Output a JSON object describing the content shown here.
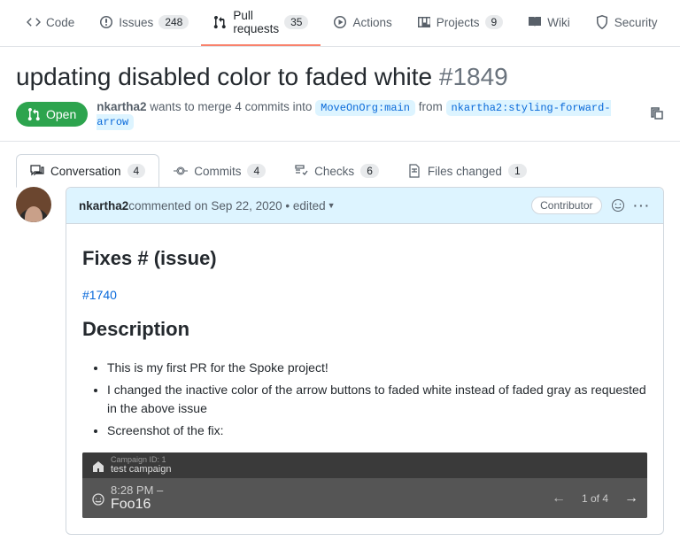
{
  "repoNav": {
    "code": "Code",
    "issues": "Issues",
    "issuesCount": "248",
    "pulls": "Pull requests",
    "pullsCount": "35",
    "actions": "Actions",
    "projects": "Projects",
    "projectsCount": "9",
    "wiki": "Wiki",
    "security": "Security"
  },
  "pr": {
    "title": "updating disabled color to faded white",
    "number": "#1849",
    "state": "Open",
    "author": "nkartha2",
    "mergeTextA": "wants to merge 4 commits into",
    "baseBranch": "MoveOnOrg:main",
    "mergeTextB": "from",
    "headBranch": "nkartha2:styling-forward-arrow"
  },
  "tabs": {
    "conversation": "Conversation",
    "conversationCount": "4",
    "commits": "Commits",
    "commitsCount": "4",
    "checks": "Checks",
    "checksCount": "6",
    "files": "Files changed",
    "filesCount": "1"
  },
  "comment": {
    "author": "nkartha2",
    "meta": " commented on Sep 22, 2020 • edited ",
    "role": "Contributor",
    "h1": "Fixes # (issue)",
    "issueLink": "#1740",
    "h2": "Description",
    "bullets": [
      "This is my first PR for the Spoke project!",
      "I changed the inactive color of the arrow buttons to faded white instead of faded gray as requested in the above issue",
      "Screenshot of the fix:"
    ]
  },
  "screenshot": {
    "campaignIdLabel": "Campaign ID: 1",
    "campaignName": "test campaign",
    "time": "8:28 PM –",
    "name": "Foo16",
    "pager": "1 of 4"
  }
}
